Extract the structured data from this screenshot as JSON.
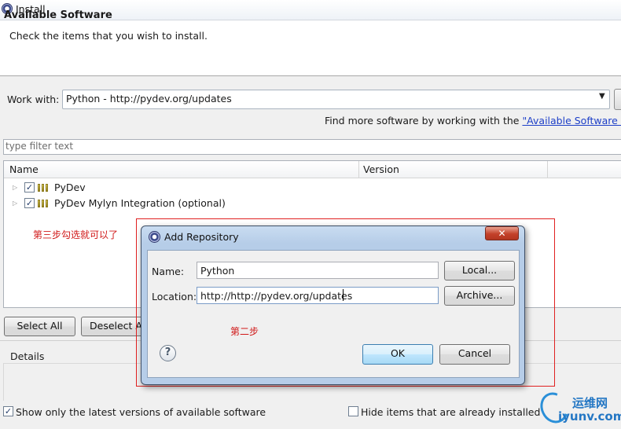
{
  "window": {
    "title": "Install"
  },
  "header": {
    "title": "Available Software",
    "subtitle": "Check the items that you wish to install."
  },
  "work_with": {
    "label": "Work with:",
    "value": "Python - http://pydev.org/updates",
    "find_more_text": "Find more software by working with the ",
    "find_more_link": "\"Available Software Sites"
  },
  "filter": {
    "placeholder": "type filter text"
  },
  "tree": {
    "columns": [
      "Name",
      "Version"
    ],
    "rows": [
      {
        "label": "PyDev",
        "checked": true,
        "version": ""
      },
      {
        "label": "PyDev Mylyn Integration (optional)",
        "checked": true,
        "version": ""
      }
    ]
  },
  "buttons": {
    "select_all": "Select All",
    "deselect_all": "Deselect All"
  },
  "details": {
    "label": "Details"
  },
  "options": {
    "show_latest": {
      "label": "Show only the latest versions of available software",
      "checked": true
    },
    "hide_installed": {
      "label": "Hide items that are already installed",
      "checked": false
    }
  },
  "annotations": {
    "step3": "第三步勾选就可以了",
    "step2": "第二步"
  },
  "dialog": {
    "title": "Add Repository",
    "close_glyph": "✕",
    "name_label": "Name:",
    "name_value": "Python",
    "location_label": "Location:",
    "location_value": "http://http://pydev.org/updates",
    "local_button": "Local...",
    "archive_button": "Archive...",
    "ok_button": "OK",
    "cancel_button": "Cancel",
    "help_glyph": "?"
  },
  "watermark": {
    "top": "运维网",
    "bottom": "iyunv.com"
  },
  "colors": {
    "annotation_red": "#d01818",
    "link_blue": "#1d3fc8",
    "dialog_frame": "#b6cde8"
  }
}
